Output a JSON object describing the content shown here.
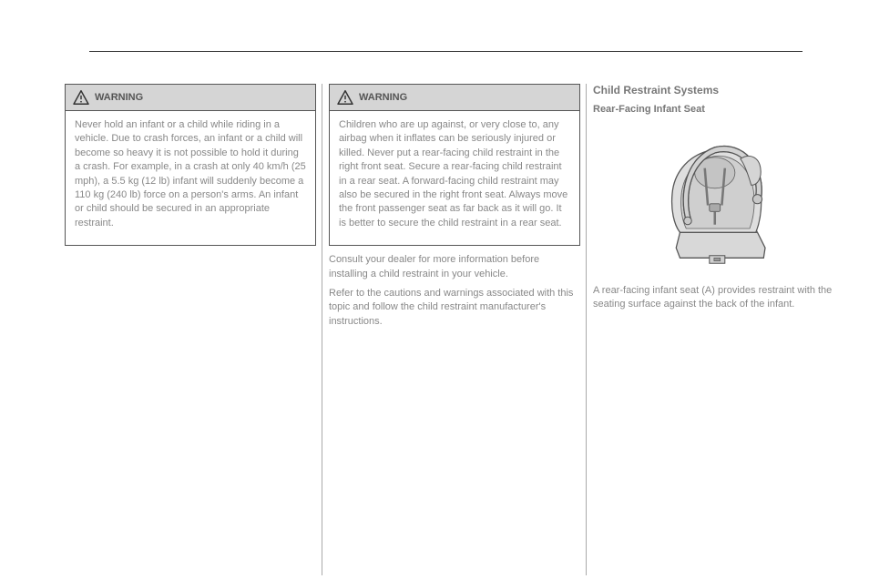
{
  "warning1": {
    "label": "WARNING",
    "p1": "Never hold an infant or a child while riding in a vehicle. Due to crash forces, an infant or a child will become so heavy it is not possible to hold it during a crash. For example, in a crash at only 40 km/h (25 mph), a 5.5 kg (12 lb) infant will suddenly become a 110 kg (240 lb) force on a person's arms. An infant or child should be secured in an appropriate restraint."
  },
  "warning2": {
    "label": "WARNING",
    "p1": "Children who are up against, or very close to, any airbag when it inflates can be seriously injured or killed. Never put a rear-facing child restraint in the right front seat. Secure a rear-facing child restraint in a rear seat. A forward-facing child restraint may also be secured in the right front seat. Always move the front passenger seat as far back as it will go. It is better to secure the child restraint in a rear seat."
  },
  "col2_text": {
    "p1": "Consult your dealer for more information before installing a child restraint in your vehicle.",
    "p2": "Refer to the cautions and warnings associated with this topic and follow the child restraint manufacturer's instructions."
  },
  "col3": {
    "heading": "Child Restraint Systems",
    "subheading": "Rear-Facing Infant Seat",
    "body": "A rear-facing infant seat (A) provides restraint with the seating surface against the back of the infant."
  }
}
